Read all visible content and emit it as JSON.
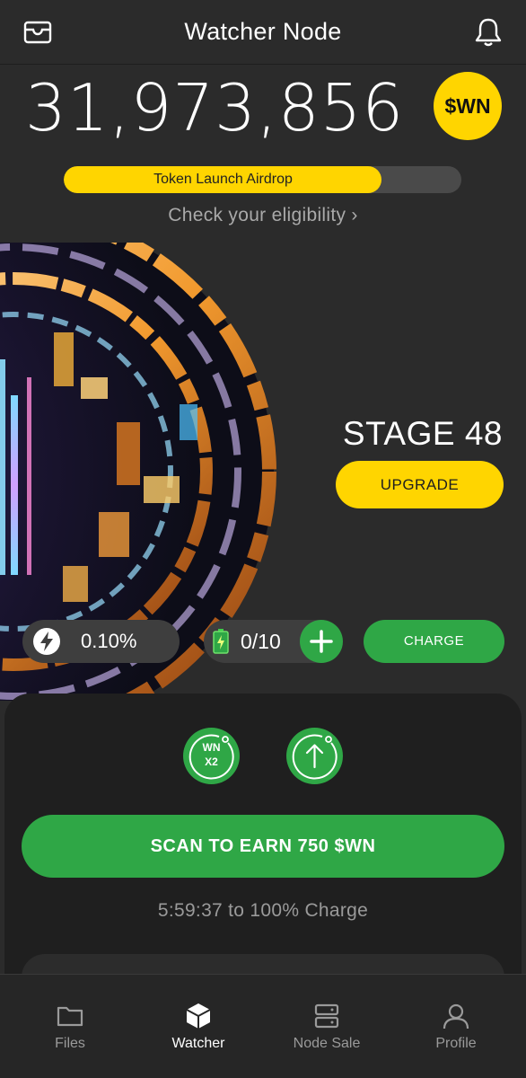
{
  "header": {
    "title": "Watcher Node",
    "left_icon": "wallet-icon",
    "right_icon": "bell-icon"
  },
  "balance": {
    "amount": "31,973,856",
    "token_badge": "$WN"
  },
  "airdrop": {
    "label": "Token Launch Airdrop",
    "progress_fraction": 0.8,
    "eligibility_link": "Check your eligibility"
  },
  "stage": {
    "label": "STAGE 48",
    "upgrade_label": "UPGRADE"
  },
  "stats": {
    "rate": "0.10%",
    "battery": "0/10",
    "charge_label": "CHARGE"
  },
  "boosts": {
    "multiplier_line1": "WN",
    "multiplier_line2": "X2"
  },
  "scan": {
    "button_label": "SCAN TO EARN 750 $WN",
    "timer_text": "5:59:37 to 100% Charge"
  },
  "nav": {
    "items": [
      {
        "label": "Files",
        "icon": "folder-icon",
        "active": false
      },
      {
        "label": "Watcher",
        "icon": "cube-icon",
        "active": true
      },
      {
        "label": "Node Sale",
        "icon": "server-icon",
        "active": false
      },
      {
        "label": "Profile",
        "icon": "user-icon",
        "active": false
      }
    ]
  },
  "colors": {
    "background": "#2b2b2b",
    "accent_yellow": "#ffd500",
    "accent_green": "#2fa746",
    "panel": "#1f1f1f"
  }
}
